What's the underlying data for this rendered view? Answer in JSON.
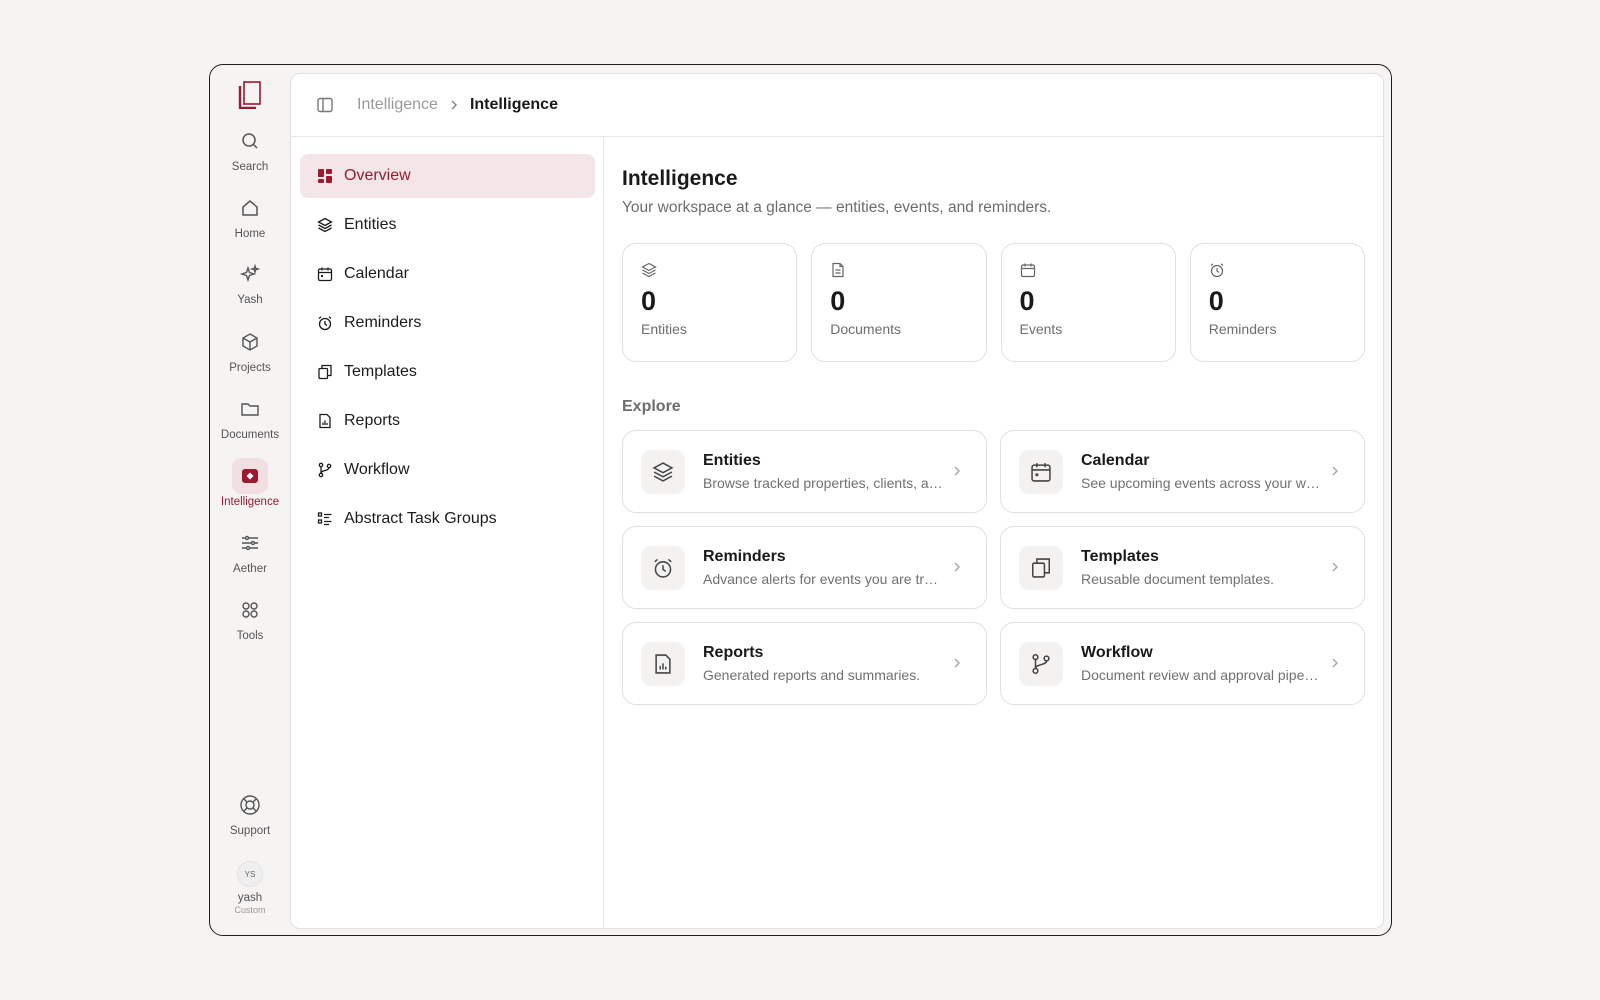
{
  "rail": {
    "items": [
      {
        "label": "Search",
        "icon": "search-icon"
      },
      {
        "label": "Home",
        "icon": "home-icon"
      },
      {
        "label": "Yash",
        "icon": "sparkles-icon"
      },
      {
        "label": "Projects",
        "icon": "box-icon"
      },
      {
        "label": "Documents",
        "icon": "folder-icon"
      },
      {
        "label": "Intelligence",
        "icon": "intelligence-icon",
        "active": true
      },
      {
        "label": "Aether",
        "icon": "sliders-icon"
      },
      {
        "label": "Tools",
        "icon": "grid-icon"
      }
    ],
    "support_label": "Support",
    "user": {
      "initials": "YS",
      "name": "yash",
      "plan": "Custom"
    }
  },
  "breadcrumb": {
    "parent": "Intelligence",
    "current": "Intelligence"
  },
  "subnav": {
    "items": [
      {
        "label": "Overview",
        "icon": "dashboard-icon",
        "active": true
      },
      {
        "label": "Entities",
        "icon": "layers-icon"
      },
      {
        "label": "Calendar",
        "icon": "calendar-icon"
      },
      {
        "label": "Reminders",
        "icon": "alarm-icon"
      },
      {
        "label": "Templates",
        "icon": "copy-icon"
      },
      {
        "label": "Reports",
        "icon": "report-icon"
      },
      {
        "label": "Workflow",
        "icon": "branch-icon"
      },
      {
        "label": "Abstract Task Groups",
        "icon": "list-icon"
      }
    ]
  },
  "main": {
    "title": "Intelligence",
    "subtitle": "Your workspace at a glance — entities, events, and reminders.",
    "stats": [
      {
        "value": "0",
        "label": "Entities",
        "icon": "layers-icon"
      },
      {
        "value": "0",
        "label": "Documents",
        "icon": "document-icon"
      },
      {
        "value": "0",
        "label": "Events",
        "icon": "calendar-icon"
      },
      {
        "value": "0",
        "label": "Reminders",
        "icon": "alarm-icon"
      }
    ],
    "explore_label": "Explore",
    "cards": [
      {
        "title": "Entities",
        "desc": "Browse tracked properties, clients, and more.",
        "icon": "layers-icon"
      },
      {
        "title": "Calendar",
        "desc": "See upcoming events across your workspace.",
        "icon": "calendar-icon"
      },
      {
        "title": "Reminders",
        "desc": "Advance alerts for events you are tracking.",
        "icon": "alarm-icon"
      },
      {
        "title": "Templates",
        "desc": "Reusable document templates.",
        "icon": "copy-icon"
      },
      {
        "title": "Reports",
        "desc": "Generated reports and summaries.",
        "icon": "report-icon"
      },
      {
        "title": "Workflow",
        "desc": "Document review and approval pipelines.",
        "icon": "branch-icon"
      }
    ]
  },
  "colors": {
    "accent": "#9a1b30",
    "accent_bg": "#f4e6e8",
    "background": "#f6f3f2"
  }
}
